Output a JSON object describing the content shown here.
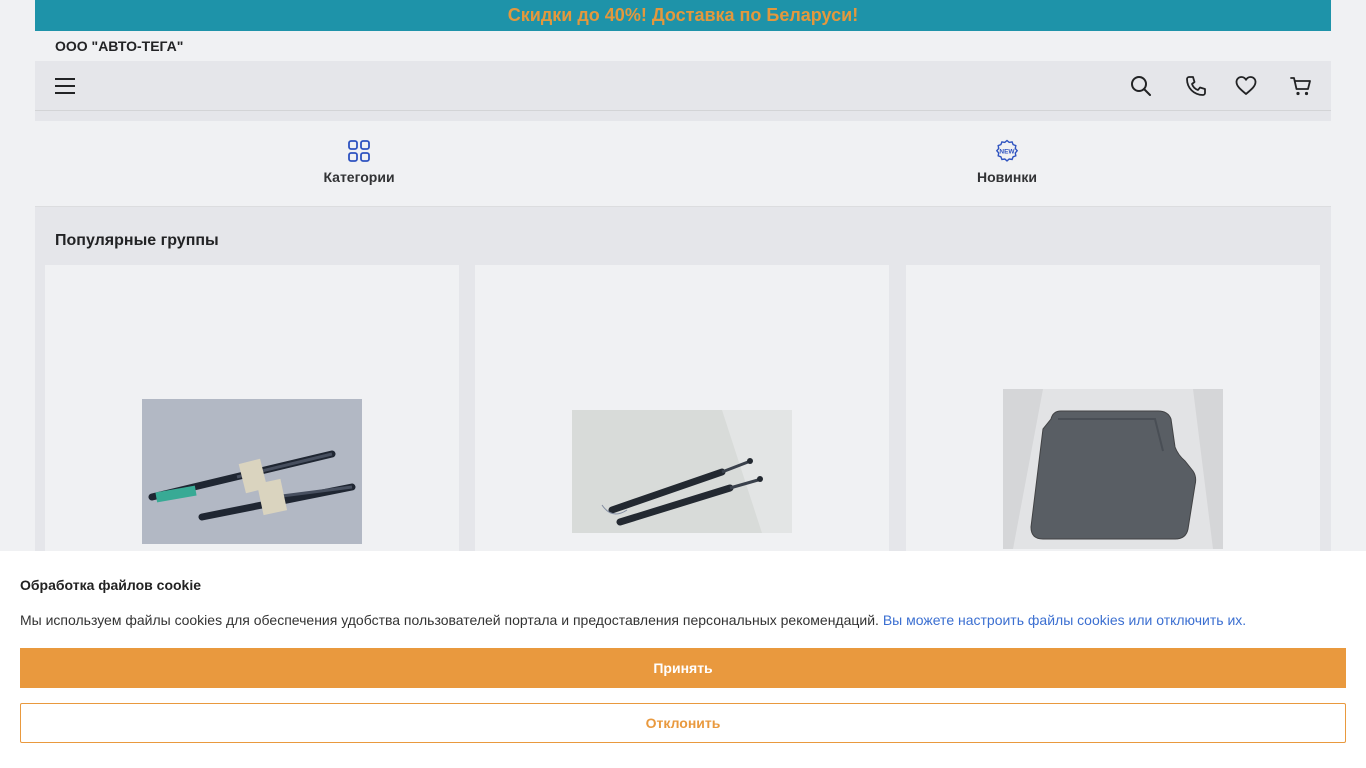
{
  "promo_banner": {
    "text": "Скидки до 40%! Доставка по Беларуси!"
  },
  "header": {
    "company_name": "ООО \"АВТО-ТЕГА\"",
    "icons": [
      "menu-icon",
      "search-icon",
      "phone-icon",
      "heart-icon",
      "cart-icon"
    ]
  },
  "quick_nav": {
    "items": [
      {
        "label": "Категории",
        "icon": "grid-icon"
      },
      {
        "label": "Новинки",
        "icon": "new-badge-icon"
      }
    ]
  },
  "popular_groups": {
    "title": "Популярные группы",
    "cards": [
      {
        "image": "gas-struts-pair-photo"
      },
      {
        "image": "gas-struts-photo"
      },
      {
        "image": "floor-mat-photo"
      }
    ]
  },
  "cookie_banner": {
    "title": "Обработка файлов cookie",
    "text": "Мы используем файлы cookies для обеспечения удобства пользователей портала и предоставления персональных рекомендаций.",
    "link_text": "Вы можете настроить файлы cookies или отключить их.",
    "accept_label": "Принять",
    "decline_label": "Отклонить"
  },
  "colors": {
    "promo_bg": "#1e9ab0",
    "promo_text": "#f2a03c",
    "accent": "#e9993e",
    "link": "#3b6fd1",
    "icon_blue": "#2f55c9"
  }
}
